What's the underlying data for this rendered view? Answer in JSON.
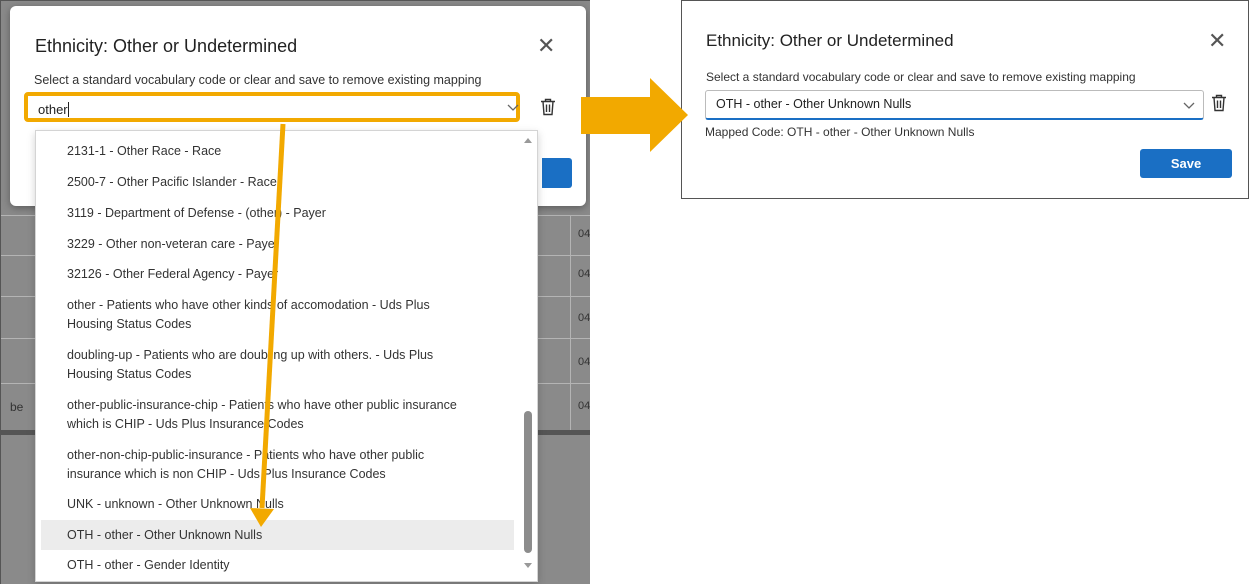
{
  "left": {
    "dialog_title": "Ethnicity: Other or Undetermined",
    "subtitle": "Select a standard vocabulary code or clear and save to remove existing mapping",
    "search_value": "other",
    "background_cells": {
      "right_col": [
        "04",
        "04",
        "04",
        "04",
        "04"
      ],
      "left_fragment": "be"
    },
    "options": [
      "2131-1 - Other Race - Race",
      "2500-7 - Other Pacific Islander - Race",
      "3119 - Department of Defense - (other) - Payer",
      "3229 - Other non-veteran care - Payer",
      "32126 - Other Federal Agency - Payer",
      "other - Patients who have other kinds of accomodation - Uds Plus",
      "Housing Status Codes",
      "doubling-up - Patients who are doubling up with others. - Uds Plus",
      "Housing Status Codes",
      "other-public-insurance-chip - Patients who have other public insurance",
      "which is CHIP - Uds Plus Insurance Codes",
      "other-non-chip-public-insurance - Patients who have other public",
      "insurance which is non CHIP - Uds Plus Insurance Codes",
      "UNK - unknown - Other Unknown Nulls",
      "OTH - other - Other Unknown Nulls",
      "OTH - other - Gender Identity"
    ]
  },
  "right": {
    "dialog_title": "Ethnicity: Other or Undetermined",
    "subtitle": "Select a standard vocabulary code or clear and save to remove existing mapping",
    "selected_value": "OTH - other - Other Unknown Nulls",
    "mapped_code": "Mapped Code: OTH - other - Other Unknown Nulls",
    "save_label": "Save"
  },
  "icons": {
    "close": "close-icon",
    "chevron": "chevron-down-icon",
    "trash": "trash-icon"
  },
  "colors": {
    "highlight": "#f2a900",
    "primary": "#1a6fc4"
  }
}
